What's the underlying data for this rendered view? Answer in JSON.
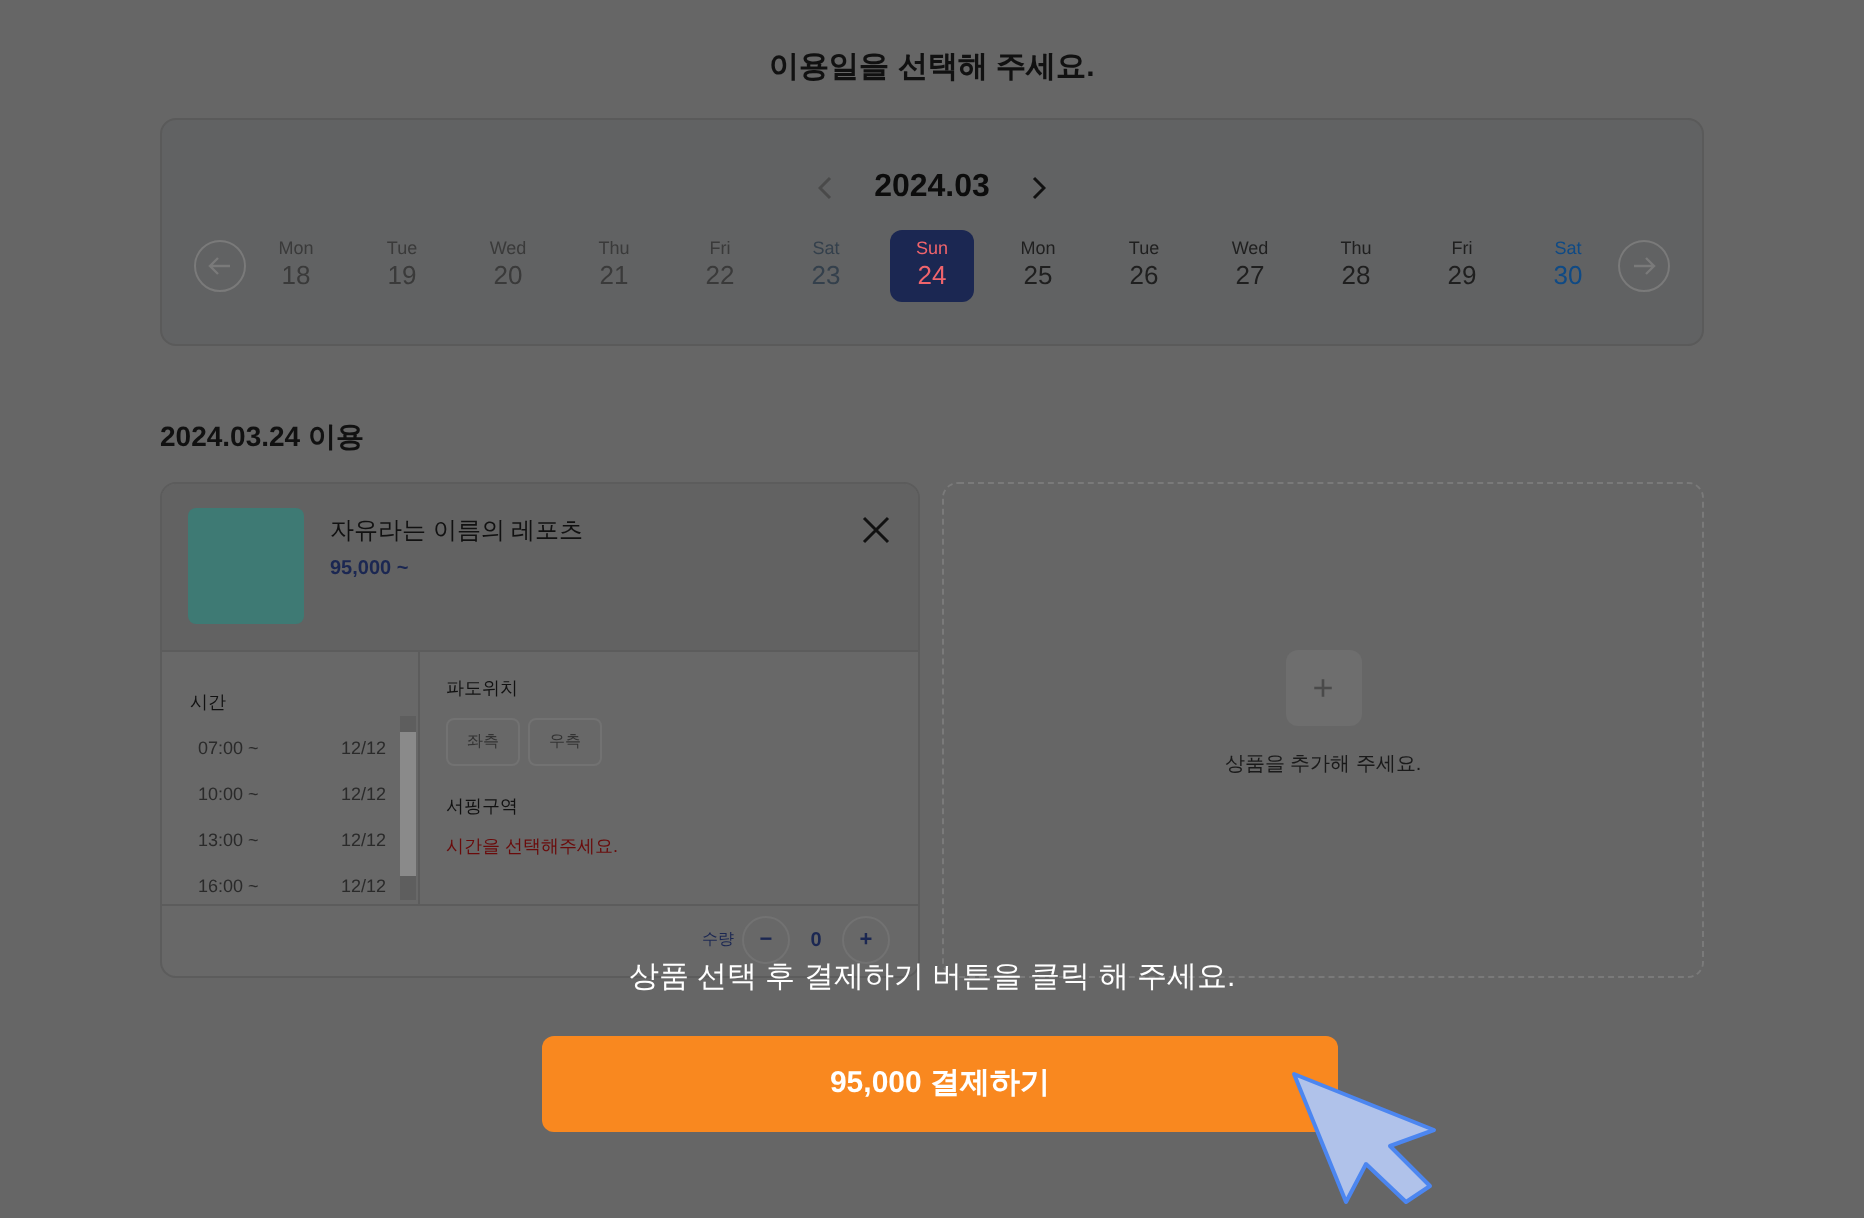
{
  "heading": "이용일을 선택해 주세요.",
  "calendar": {
    "month": "2024.03",
    "days": [
      {
        "day": "Mon",
        "date": "18",
        "kind": "weekday",
        "disabled": true,
        "selected": false
      },
      {
        "day": "Tue",
        "date": "19",
        "kind": "weekday",
        "disabled": true,
        "selected": false
      },
      {
        "day": "Wed",
        "date": "20",
        "kind": "weekday",
        "disabled": true,
        "selected": false
      },
      {
        "day": "Thu",
        "date": "21",
        "kind": "weekday",
        "disabled": true,
        "selected": false
      },
      {
        "day": "Fri",
        "date": "22",
        "kind": "weekday",
        "disabled": true,
        "selected": false
      },
      {
        "day": "Sat",
        "date": "23",
        "kind": "sat",
        "disabled": true,
        "selected": false
      },
      {
        "day": "Sun",
        "date": "24",
        "kind": "sun",
        "disabled": false,
        "selected": true
      },
      {
        "day": "Mon",
        "date": "25",
        "kind": "weekday",
        "disabled": false,
        "selected": false
      },
      {
        "day": "Tue",
        "date": "26",
        "kind": "weekday",
        "disabled": false,
        "selected": false
      },
      {
        "day": "Wed",
        "date": "27",
        "kind": "weekday",
        "disabled": false,
        "selected": false
      },
      {
        "day": "Thu",
        "date": "28",
        "kind": "weekday",
        "disabled": false,
        "selected": false
      },
      {
        "day": "Fri",
        "date": "29",
        "kind": "weekday",
        "disabled": false,
        "selected": false
      },
      {
        "day": "Sat",
        "date": "30",
        "kind": "sat",
        "disabled": false,
        "selected": false
      }
    ]
  },
  "section_title": "2024.03.24 이용",
  "product": {
    "name": "자유라는 이름의 레포츠",
    "price": "95,000 ~",
    "time_label": "시간",
    "times": [
      {
        "time": "07:00 ~",
        "count": "12/12"
      },
      {
        "time": "10:00 ~",
        "count": "12/12"
      },
      {
        "time": "13:00 ~",
        "count": "12/12"
      },
      {
        "time": "16:00 ~",
        "count": "12/12"
      }
    ],
    "wave_label": "파도위치",
    "wave_options": [
      "좌측",
      "우측"
    ],
    "zone_label": "서핑구역",
    "zone_message": "시간을 선택해주세요.",
    "quantity_label": "수량",
    "quantity_minus": "−",
    "quantity": "0",
    "quantity_plus": "+"
  },
  "add_card": {
    "icon": "+",
    "text": "상품을 추가해 주세요."
  },
  "overlay_hint": "상품 선택 후 결제하기 버튼을 클릭 해 주세요.",
  "pay_button": "95,000 결제하기"
}
